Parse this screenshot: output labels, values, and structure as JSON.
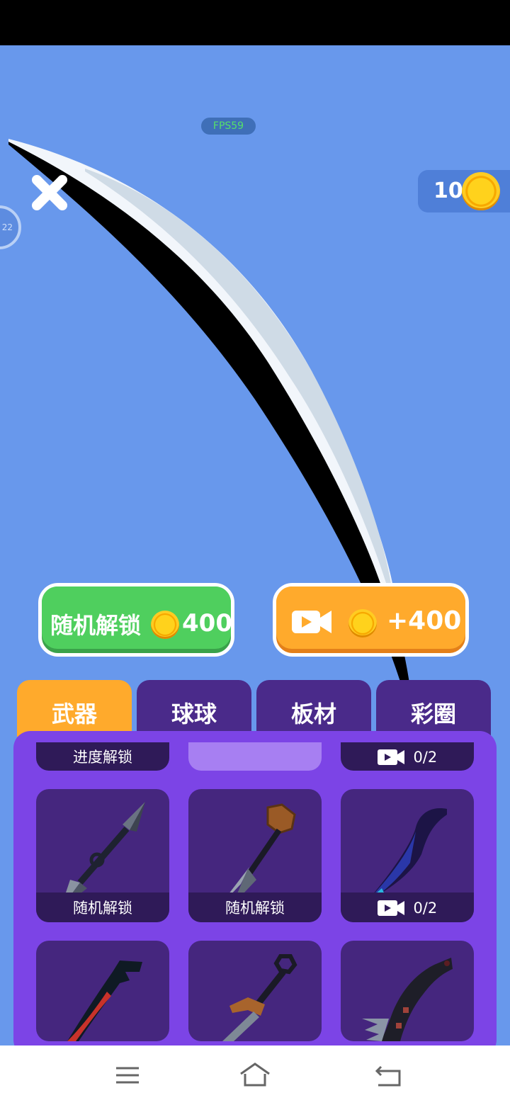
{
  "hud": {
    "fps": "FPS59",
    "ring_label": "22",
    "coin_count": "10"
  },
  "buttons": {
    "random_unlock": {
      "label": "随机解锁",
      "price": "400"
    },
    "video_reward": {
      "reward": "+400"
    }
  },
  "tabs": [
    {
      "label": "武器",
      "active": true
    },
    {
      "label": "球球",
      "active": false
    },
    {
      "label": "板材",
      "active": false
    },
    {
      "label": "彩圈",
      "active": false
    }
  ],
  "top_strips": [
    {
      "label": "进度解锁"
    },
    {
      "label": ""
    },
    {
      "label": "0/2",
      "icon": "video-icon"
    }
  ],
  "items": [
    {
      "name": "kunai",
      "caption": "随机解锁",
      "icon": ""
    },
    {
      "name": "ornate-dagger",
      "caption": "随机解锁",
      "icon": ""
    },
    {
      "name": "purple-knife",
      "caption": "0/2",
      "icon": "video-icon"
    },
    {
      "name": "red-karambit",
      "caption": "",
      "icon": ""
    },
    {
      "name": "bronze-sai",
      "caption": "",
      "icon": ""
    },
    {
      "name": "dark-serrated-blade",
      "caption": "",
      "icon": ""
    }
  ],
  "colors": {
    "background": "#6898ec",
    "green_button": "#4fcf5e",
    "orange_button": "#ffaa2c",
    "active_tab": "#ffaa2c",
    "tab": "#4a2a8a",
    "panel": "#7c44e6",
    "card": "#45267e"
  },
  "nav": [
    "menu-icon",
    "home-icon",
    "back-icon"
  ]
}
